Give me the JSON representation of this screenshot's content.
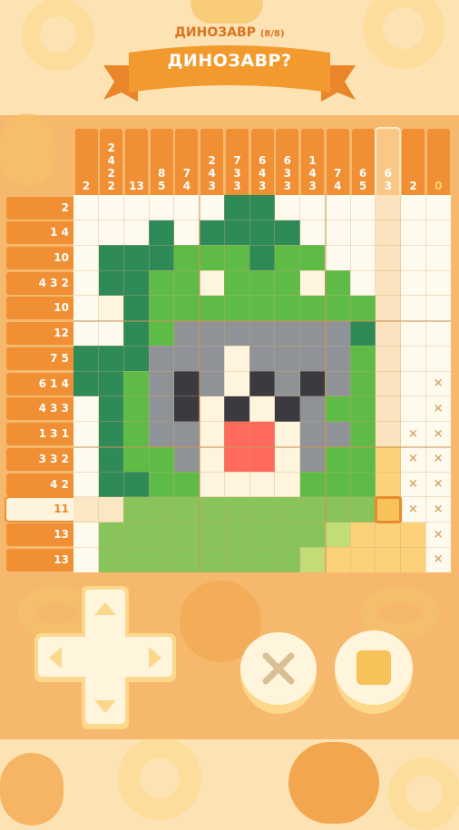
{
  "header": {
    "subtitle_label": "ДИНОЗАВР",
    "progress": "(8/8)",
    "banner_title": "ДИНОЗАВР?"
  },
  "column_clues": [
    [
      "2"
    ],
    [
      "2",
      "4",
      "2",
      "2"
    ],
    [
      "13"
    ],
    [
      "8",
      "5"
    ],
    [
      "7",
      "4"
    ],
    [
      "2",
      "4",
      "3"
    ],
    [
      "7",
      "3",
      "3"
    ],
    [
      "6",
      "4",
      "3"
    ],
    [
      "6",
      "3",
      "3"
    ],
    [
      "1",
      "4",
      "3"
    ],
    [
      "7",
      "4"
    ],
    [
      "6",
      "5"
    ],
    [
      "6",
      "3"
    ],
    [
      "2"
    ],
    [
      "0"
    ]
  ],
  "active_column": 12,
  "row_clues": [
    "2",
    "1 4",
    "10",
    "4 3 2",
    "10",
    "12",
    "7 5",
    "6 1 4",
    "4 3 3",
    "1 3 1",
    "3 3 2",
    "4 2",
    "11",
    "13",
    "13"
  ],
  "active_row": 12,
  "grid_rows": [
    "WWWWWWDDWWWWPWW",
    "WWWDWDDDDWWWPWW",
    "WDDDGGGDGGWWPWW",
    "WDDGGCGGGCGWPWW",
    "WCDGGGGGGGGGPWW",
    "WWDGSSSSSSSDPWW",
    "DDDSSSCSSSSGPWW",
    "DDGSKSCKSKSGPWX",
    "WDGSKCKCKSGGPWX",
    "WDGSSCRRCSSGPXX",
    "WDGGSCRRCSGGYXX",
    "WDDGGCCCCGGGYXX",
    "ppLLLLLLLLLLAXX",
    "WLLLLLLLLLBYYYX",
    "WLLLLLLLLBYYYYX"
  ],
  "cell_colors": {
    "W": "#fffaee",
    "P": "#fbe3bf",
    "D": "#2e8b57",
    "G": "#5dbb46",
    "C": "#fff4de",
    "S": "#8f9296",
    "K": "#3a3a40",
    "R": "#ff6a5c",
    "Y": "#fbd27a",
    "L": "#88c45a",
    "p": "#fbe7c4",
    "A": "#f7c259",
    "B": "#c2dc78",
    "X": "#fffaee"
  },
  "crossed_mark": "×",
  "controls": {
    "dpad_icon": "dpad-icon",
    "cross_button_icon": "cross-icon",
    "fill_button_icon": "square-icon"
  },
  "colors": {
    "background": "#fde3b4",
    "board": "#f6b86c",
    "clue_orange": "#f08f33",
    "banner": "#f39a2e"
  }
}
